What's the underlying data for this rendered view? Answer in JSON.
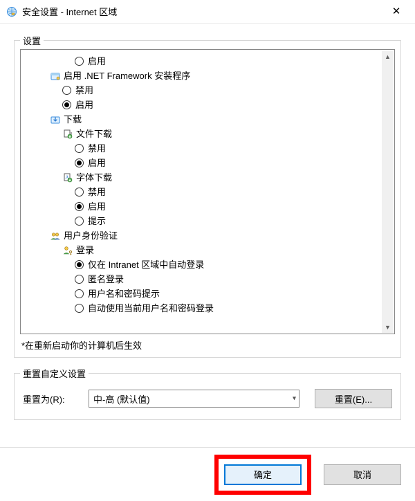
{
  "window": {
    "title": "安全设置 - Internet 区域",
    "close": "✕"
  },
  "settings": {
    "label": "设置",
    "items": {
      "enable0": "启用",
      "netfx": "启用 .NET Framework 安装程序",
      "netfx_disable": "禁用",
      "netfx_enable": "启用",
      "download": "下载",
      "file_dl": "文件下载",
      "file_dl_disable": "禁用",
      "file_dl_enable": "启用",
      "font_dl": "字体下载",
      "font_dl_disable": "禁用",
      "font_dl_enable": "启用",
      "font_dl_prompt": "提示",
      "auth": "用户身份验证",
      "login": "登录",
      "login_intranet": "仅在 Intranet 区域中自动登录",
      "login_anon": "匿名登录",
      "login_prompt": "用户名和密码提示",
      "login_auto": "自动使用当前用户名和密码登录"
    },
    "footnote": "*在重新启动你的计算机后生效"
  },
  "reset": {
    "group_label": "重置自定义设置",
    "label": "重置为(R):",
    "value": "中-高 (默认值)",
    "button": "重置(E)..."
  },
  "buttons": {
    "ok": "确定",
    "cancel": "取消"
  }
}
